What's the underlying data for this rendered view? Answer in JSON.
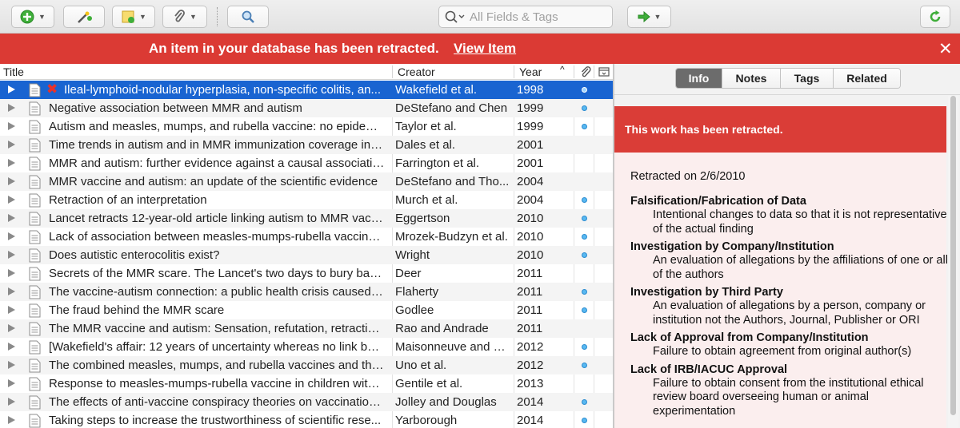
{
  "toolbar": {
    "search_placeholder": "All Fields & Tags"
  },
  "banner": {
    "message": "An item in your database has been retracted.",
    "link": "View Item",
    "close": "✕"
  },
  "columns": {
    "title": "Title",
    "creator": "Creator",
    "year": "Year"
  },
  "items": [
    {
      "title": "Ileal-lymphoid-nodular hyperplasia, non-specific colitis, an...",
      "creator": "Wakefield et al.",
      "year": "1998",
      "attachment": true,
      "retracted": true,
      "selected": true
    },
    {
      "title": "Negative association between MMR and autism",
      "creator": "DeStefano and Chen",
      "year": "1999",
      "attachment": true
    },
    {
      "title": "Autism and measles, mumps, and rubella vaccine: no epidemio...",
      "creator": "Taylor et al.",
      "year": "1999",
      "attachment": true
    },
    {
      "title": "Time trends in autism and in MMR immunization coverage in C...",
      "creator": "Dales et al.",
      "year": "2001",
      "attachment": false
    },
    {
      "title": "MMR and autism: further evidence against a causal association",
      "creator": "Farrington et al.",
      "year": "2001",
      "attachment": false
    },
    {
      "title": "MMR vaccine and autism: an update of the scientific evidence",
      "creator": "DeStefano and Tho...",
      "year": "2004",
      "attachment": false
    },
    {
      "title": "Retraction of an interpretation",
      "creator": "Murch et al.",
      "year": "2004",
      "attachment": true
    },
    {
      "title": "Lancet retracts 12-year-old article linking autism to MMR vacci...",
      "creator": "Eggertson",
      "year": "2010",
      "attachment": true
    },
    {
      "title": "Lack of association between measles-mumps-rubella vaccinati...",
      "creator": "Mrozek-Budzyn et al.",
      "year": "2010",
      "attachment": true
    },
    {
      "title": "Does autistic enterocolitis exist?",
      "creator": "Wright",
      "year": "2010",
      "attachment": true
    },
    {
      "title": "Secrets of the MMR scare. The Lancet's two days to bury bad ...",
      "creator": "Deer",
      "year": "2011",
      "attachment": false
    },
    {
      "title": "The vaccine-autism connection: a public health crisis caused b...",
      "creator": "Flaherty",
      "year": "2011",
      "attachment": true
    },
    {
      "title": "The fraud behind the MMR scare",
      "creator": "Godlee",
      "year": "2011",
      "attachment": true
    },
    {
      "title": "The MMR vaccine and autism: Sensation, refutation, retraction...",
      "creator": "Rao and Andrade",
      "year": "2011",
      "attachment": false
    },
    {
      "title": "[Wakefield's affair: 12 years of uncertainty whereas no link bet...",
      "creator": "Maisonneuve and Fl...",
      "year": "2012",
      "attachment": true
    },
    {
      "title": "The combined measles, mumps, and rubella vaccines and the t...",
      "creator": "Uno et al.",
      "year": "2012",
      "attachment": true
    },
    {
      "title": "Response to measles-mumps-rubella vaccine in children with ...",
      "creator": "Gentile et al.",
      "year": "2013",
      "attachment": false
    },
    {
      "title": "The effects of anti-vaccine conspiracy theories on vaccination...",
      "creator": "Jolley and Douglas",
      "year": "2014",
      "attachment": true
    },
    {
      "title": "Taking steps to increase the trustworthiness of scientific rese...",
      "creator": "Yarborough",
      "year": "2014",
      "attachment": true
    }
  ],
  "tabs": [
    "Info",
    "Notes",
    "Tags",
    "Related"
  ],
  "retraction": {
    "notice": "This work has been retracted.",
    "date": "Retracted on 2/6/2010",
    "reasons": [
      {
        "title": "Falsification/Fabrication of Data",
        "desc": "Intentional changes to data so that it is not representative of the actual finding"
      },
      {
        "title": "Investigation by Company/Institution",
        "desc": "An evaluation of allegations by the affiliations of one or all of the authors"
      },
      {
        "title": "Investigation by Third Party",
        "desc": "An evaluation of allegations by a person, company or institution not the Authors, Journal, Publisher or ORI"
      },
      {
        "title": "Lack of Approval from Company/Institution",
        "desc": "Failure to obtain agreement from original author(s)"
      },
      {
        "title": "Lack of IRB/IACUC Approval",
        "desc": "Failure to obtain consent from the institutional ethical review board overseeing human or animal experimentation"
      }
    ]
  }
}
